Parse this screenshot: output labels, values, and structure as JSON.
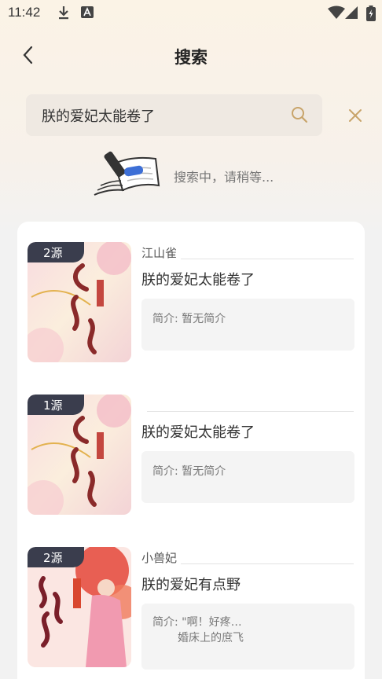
{
  "status_bar": {
    "time": "11:42"
  },
  "header": {
    "title": "搜索",
    "back_icon": "chevron-left-icon"
  },
  "search": {
    "value": "朕的爱妃太能卷了",
    "icon": "search-icon",
    "close_icon": "close-icon"
  },
  "searching": {
    "text": "搜索中，请稍等..."
  },
  "results": [
    {
      "badge": "2源",
      "author": "江山雀",
      "title": "朕的爱妃太能卷了",
      "intro": "简介: 暂无简介"
    },
    {
      "badge": "1源",
      "author": "",
      "title": "朕的爱妃太能卷了",
      "intro": "简介: 暂无简介"
    },
    {
      "badge": "2源",
      "author": "小兽妃",
      "title": "朕的爱妃有点野",
      "intro": "简介: \"啊！好疼…",
      "intro_line2": "婚床上的庶飞"
    }
  ],
  "colors": {
    "accent": "#c8a46a",
    "badge": "#3a3d4d",
    "search_bg": "#efe9e2"
  }
}
